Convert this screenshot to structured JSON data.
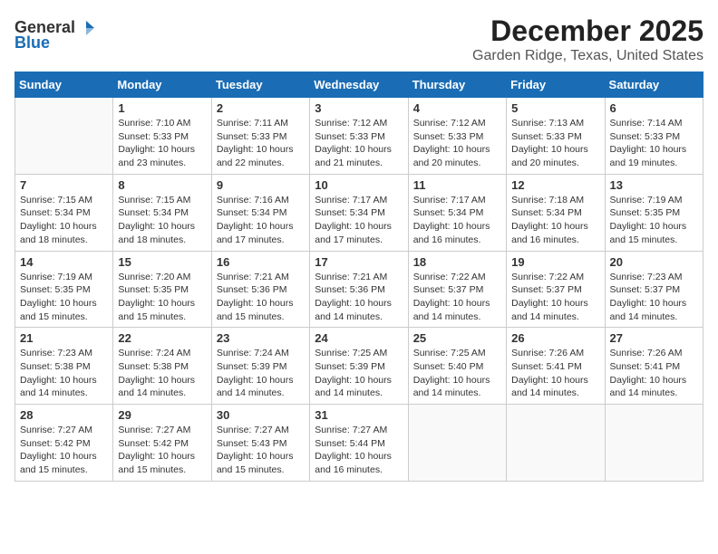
{
  "logo": {
    "general": "General",
    "blue": "Blue"
  },
  "header": {
    "title": "December 2025",
    "subtitle": "Garden Ridge, Texas, United States"
  },
  "weekdays": [
    "Sunday",
    "Monday",
    "Tuesday",
    "Wednesday",
    "Thursday",
    "Friday",
    "Saturday"
  ],
  "weeks": [
    [
      {
        "day": "",
        "info": ""
      },
      {
        "day": "1",
        "info": "Sunrise: 7:10 AM\nSunset: 5:33 PM\nDaylight: 10 hours\nand 23 minutes."
      },
      {
        "day": "2",
        "info": "Sunrise: 7:11 AM\nSunset: 5:33 PM\nDaylight: 10 hours\nand 22 minutes."
      },
      {
        "day": "3",
        "info": "Sunrise: 7:12 AM\nSunset: 5:33 PM\nDaylight: 10 hours\nand 21 minutes."
      },
      {
        "day": "4",
        "info": "Sunrise: 7:12 AM\nSunset: 5:33 PM\nDaylight: 10 hours\nand 20 minutes."
      },
      {
        "day": "5",
        "info": "Sunrise: 7:13 AM\nSunset: 5:33 PM\nDaylight: 10 hours\nand 20 minutes."
      },
      {
        "day": "6",
        "info": "Sunrise: 7:14 AM\nSunset: 5:33 PM\nDaylight: 10 hours\nand 19 minutes."
      }
    ],
    [
      {
        "day": "7",
        "info": "Sunrise: 7:15 AM\nSunset: 5:34 PM\nDaylight: 10 hours\nand 18 minutes."
      },
      {
        "day": "8",
        "info": "Sunrise: 7:15 AM\nSunset: 5:34 PM\nDaylight: 10 hours\nand 18 minutes."
      },
      {
        "day": "9",
        "info": "Sunrise: 7:16 AM\nSunset: 5:34 PM\nDaylight: 10 hours\nand 17 minutes."
      },
      {
        "day": "10",
        "info": "Sunrise: 7:17 AM\nSunset: 5:34 PM\nDaylight: 10 hours\nand 17 minutes."
      },
      {
        "day": "11",
        "info": "Sunrise: 7:17 AM\nSunset: 5:34 PM\nDaylight: 10 hours\nand 16 minutes."
      },
      {
        "day": "12",
        "info": "Sunrise: 7:18 AM\nSunset: 5:34 PM\nDaylight: 10 hours\nand 16 minutes."
      },
      {
        "day": "13",
        "info": "Sunrise: 7:19 AM\nSunset: 5:35 PM\nDaylight: 10 hours\nand 15 minutes."
      }
    ],
    [
      {
        "day": "14",
        "info": "Sunrise: 7:19 AM\nSunset: 5:35 PM\nDaylight: 10 hours\nand 15 minutes."
      },
      {
        "day": "15",
        "info": "Sunrise: 7:20 AM\nSunset: 5:35 PM\nDaylight: 10 hours\nand 15 minutes."
      },
      {
        "day": "16",
        "info": "Sunrise: 7:21 AM\nSunset: 5:36 PM\nDaylight: 10 hours\nand 15 minutes."
      },
      {
        "day": "17",
        "info": "Sunrise: 7:21 AM\nSunset: 5:36 PM\nDaylight: 10 hours\nand 14 minutes."
      },
      {
        "day": "18",
        "info": "Sunrise: 7:22 AM\nSunset: 5:37 PM\nDaylight: 10 hours\nand 14 minutes."
      },
      {
        "day": "19",
        "info": "Sunrise: 7:22 AM\nSunset: 5:37 PM\nDaylight: 10 hours\nand 14 minutes."
      },
      {
        "day": "20",
        "info": "Sunrise: 7:23 AM\nSunset: 5:37 PM\nDaylight: 10 hours\nand 14 minutes."
      }
    ],
    [
      {
        "day": "21",
        "info": "Sunrise: 7:23 AM\nSunset: 5:38 PM\nDaylight: 10 hours\nand 14 minutes."
      },
      {
        "day": "22",
        "info": "Sunrise: 7:24 AM\nSunset: 5:38 PM\nDaylight: 10 hours\nand 14 minutes."
      },
      {
        "day": "23",
        "info": "Sunrise: 7:24 AM\nSunset: 5:39 PM\nDaylight: 10 hours\nand 14 minutes."
      },
      {
        "day": "24",
        "info": "Sunrise: 7:25 AM\nSunset: 5:39 PM\nDaylight: 10 hours\nand 14 minutes."
      },
      {
        "day": "25",
        "info": "Sunrise: 7:25 AM\nSunset: 5:40 PM\nDaylight: 10 hours\nand 14 minutes."
      },
      {
        "day": "26",
        "info": "Sunrise: 7:26 AM\nSunset: 5:41 PM\nDaylight: 10 hours\nand 14 minutes."
      },
      {
        "day": "27",
        "info": "Sunrise: 7:26 AM\nSunset: 5:41 PM\nDaylight: 10 hours\nand 14 minutes."
      }
    ],
    [
      {
        "day": "28",
        "info": "Sunrise: 7:27 AM\nSunset: 5:42 PM\nDaylight: 10 hours\nand 15 minutes."
      },
      {
        "day": "29",
        "info": "Sunrise: 7:27 AM\nSunset: 5:42 PM\nDaylight: 10 hours\nand 15 minutes."
      },
      {
        "day": "30",
        "info": "Sunrise: 7:27 AM\nSunset: 5:43 PM\nDaylight: 10 hours\nand 15 minutes."
      },
      {
        "day": "31",
        "info": "Sunrise: 7:27 AM\nSunset: 5:44 PM\nDaylight: 10 hours\nand 16 minutes."
      },
      {
        "day": "",
        "info": ""
      },
      {
        "day": "",
        "info": ""
      },
      {
        "day": "",
        "info": ""
      }
    ]
  ]
}
